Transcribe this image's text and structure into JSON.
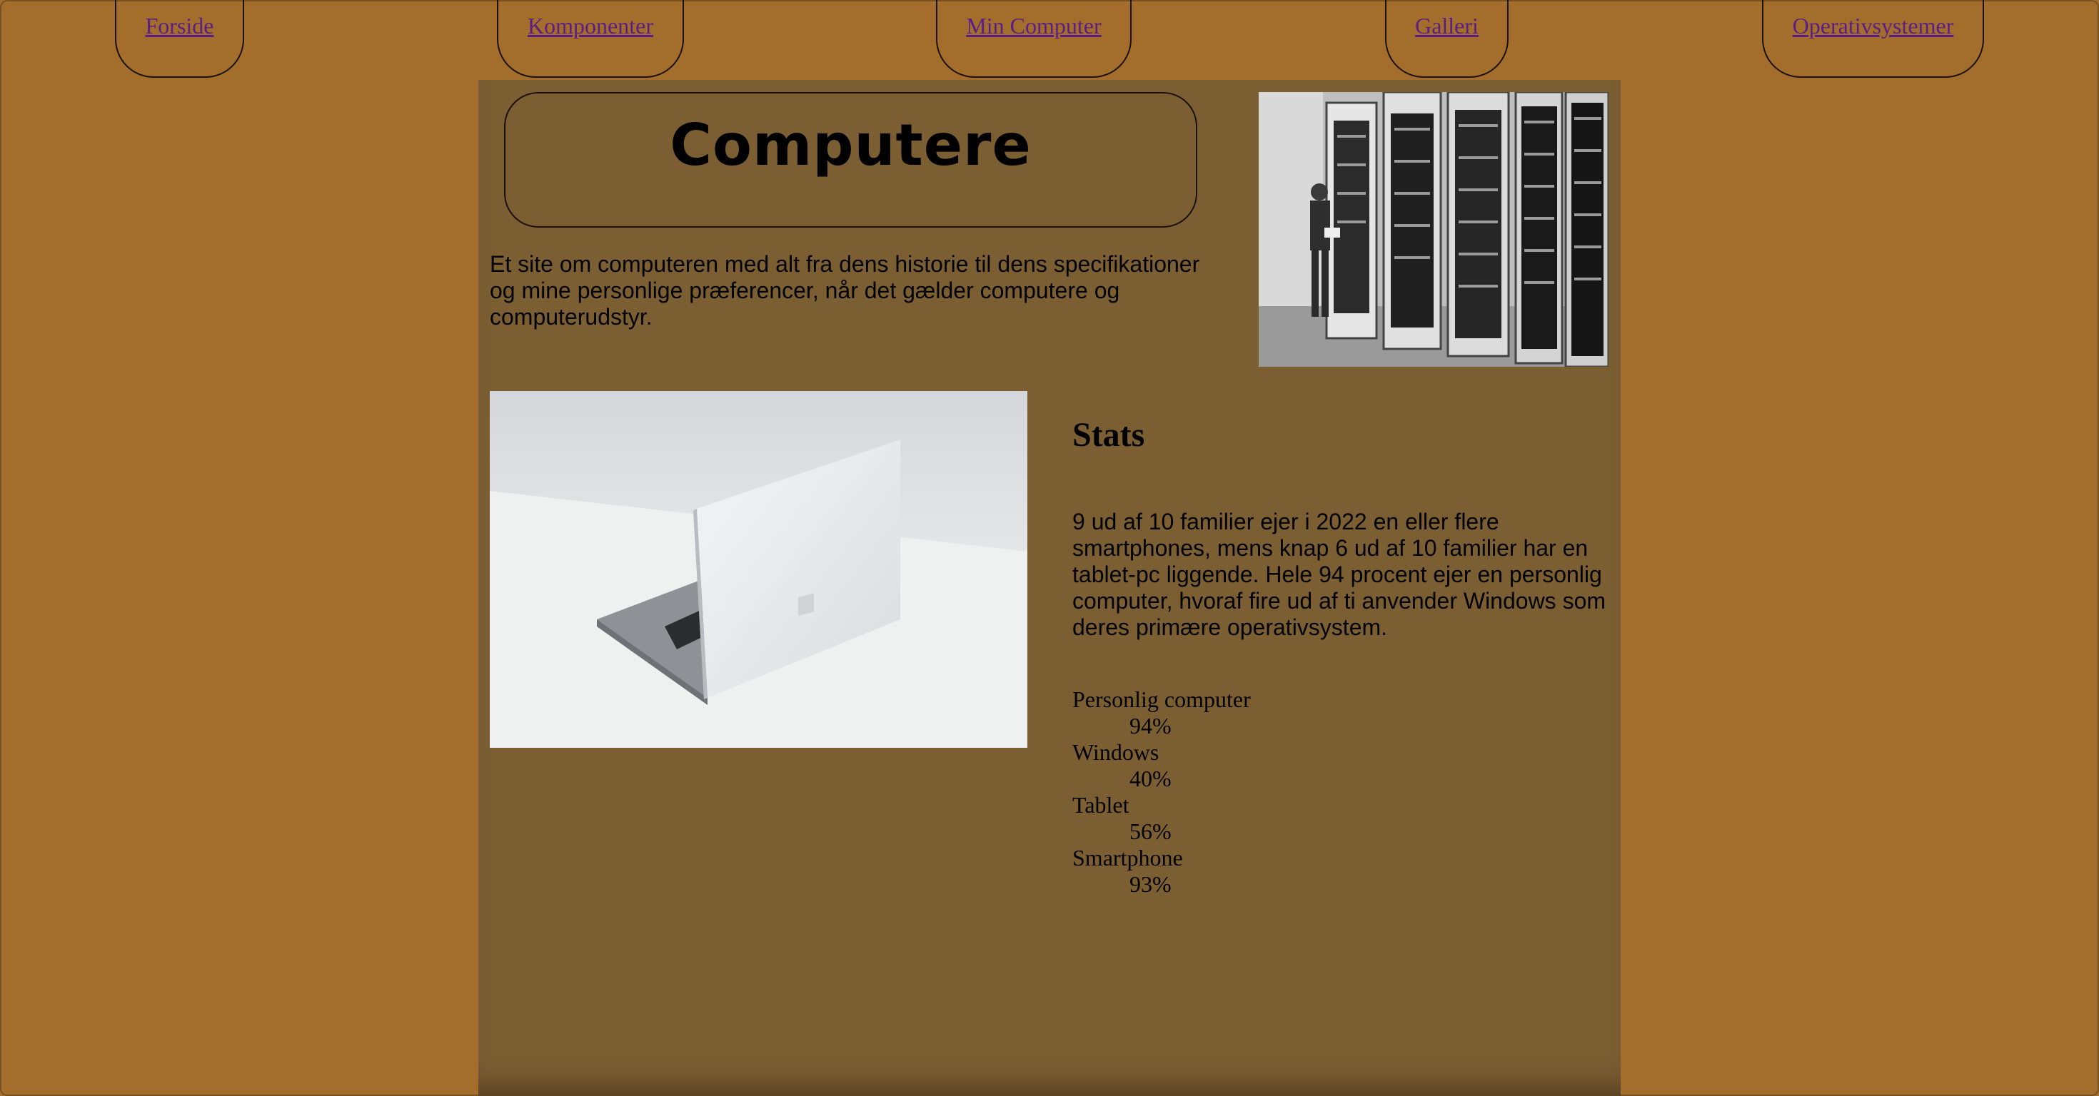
{
  "nav": {
    "items": [
      {
        "label": "Forside"
      },
      {
        "label": "Komponenter"
      },
      {
        "label": "Min Computer"
      },
      {
        "label": "Galleri"
      },
      {
        "label": "Operativsystemer"
      }
    ]
  },
  "header": {
    "title": "Computere"
  },
  "intro": {
    "text": "Et site om computeren med alt fra dens historie til dens specifikationer og mine personlige præferencer, når det gælder computere og computerudstyr."
  },
  "stats": {
    "title": "Stats",
    "text": "9 ud af 10 familier ejer i 2022 en eller flere smartphones, mens knap 6 ud af 10 familier har en tablet-pc liggende. Hele 94 procent ejer en personlig computer, hvoraf fire ud af ti anvender Windows som deres primære operativsystem.",
    "items": [
      {
        "term": "Personlig computer",
        "value": "94%"
      },
      {
        "term": "Windows",
        "value": "40%"
      },
      {
        "term": "Tablet",
        "value": "56%"
      },
      {
        "term": "Smartphone",
        "value": "93%"
      }
    ]
  },
  "colors": {
    "page_background": "#a36d2b",
    "panel_background": "#7c5e33",
    "link": "#5a1e86",
    "text": "#000000"
  }
}
